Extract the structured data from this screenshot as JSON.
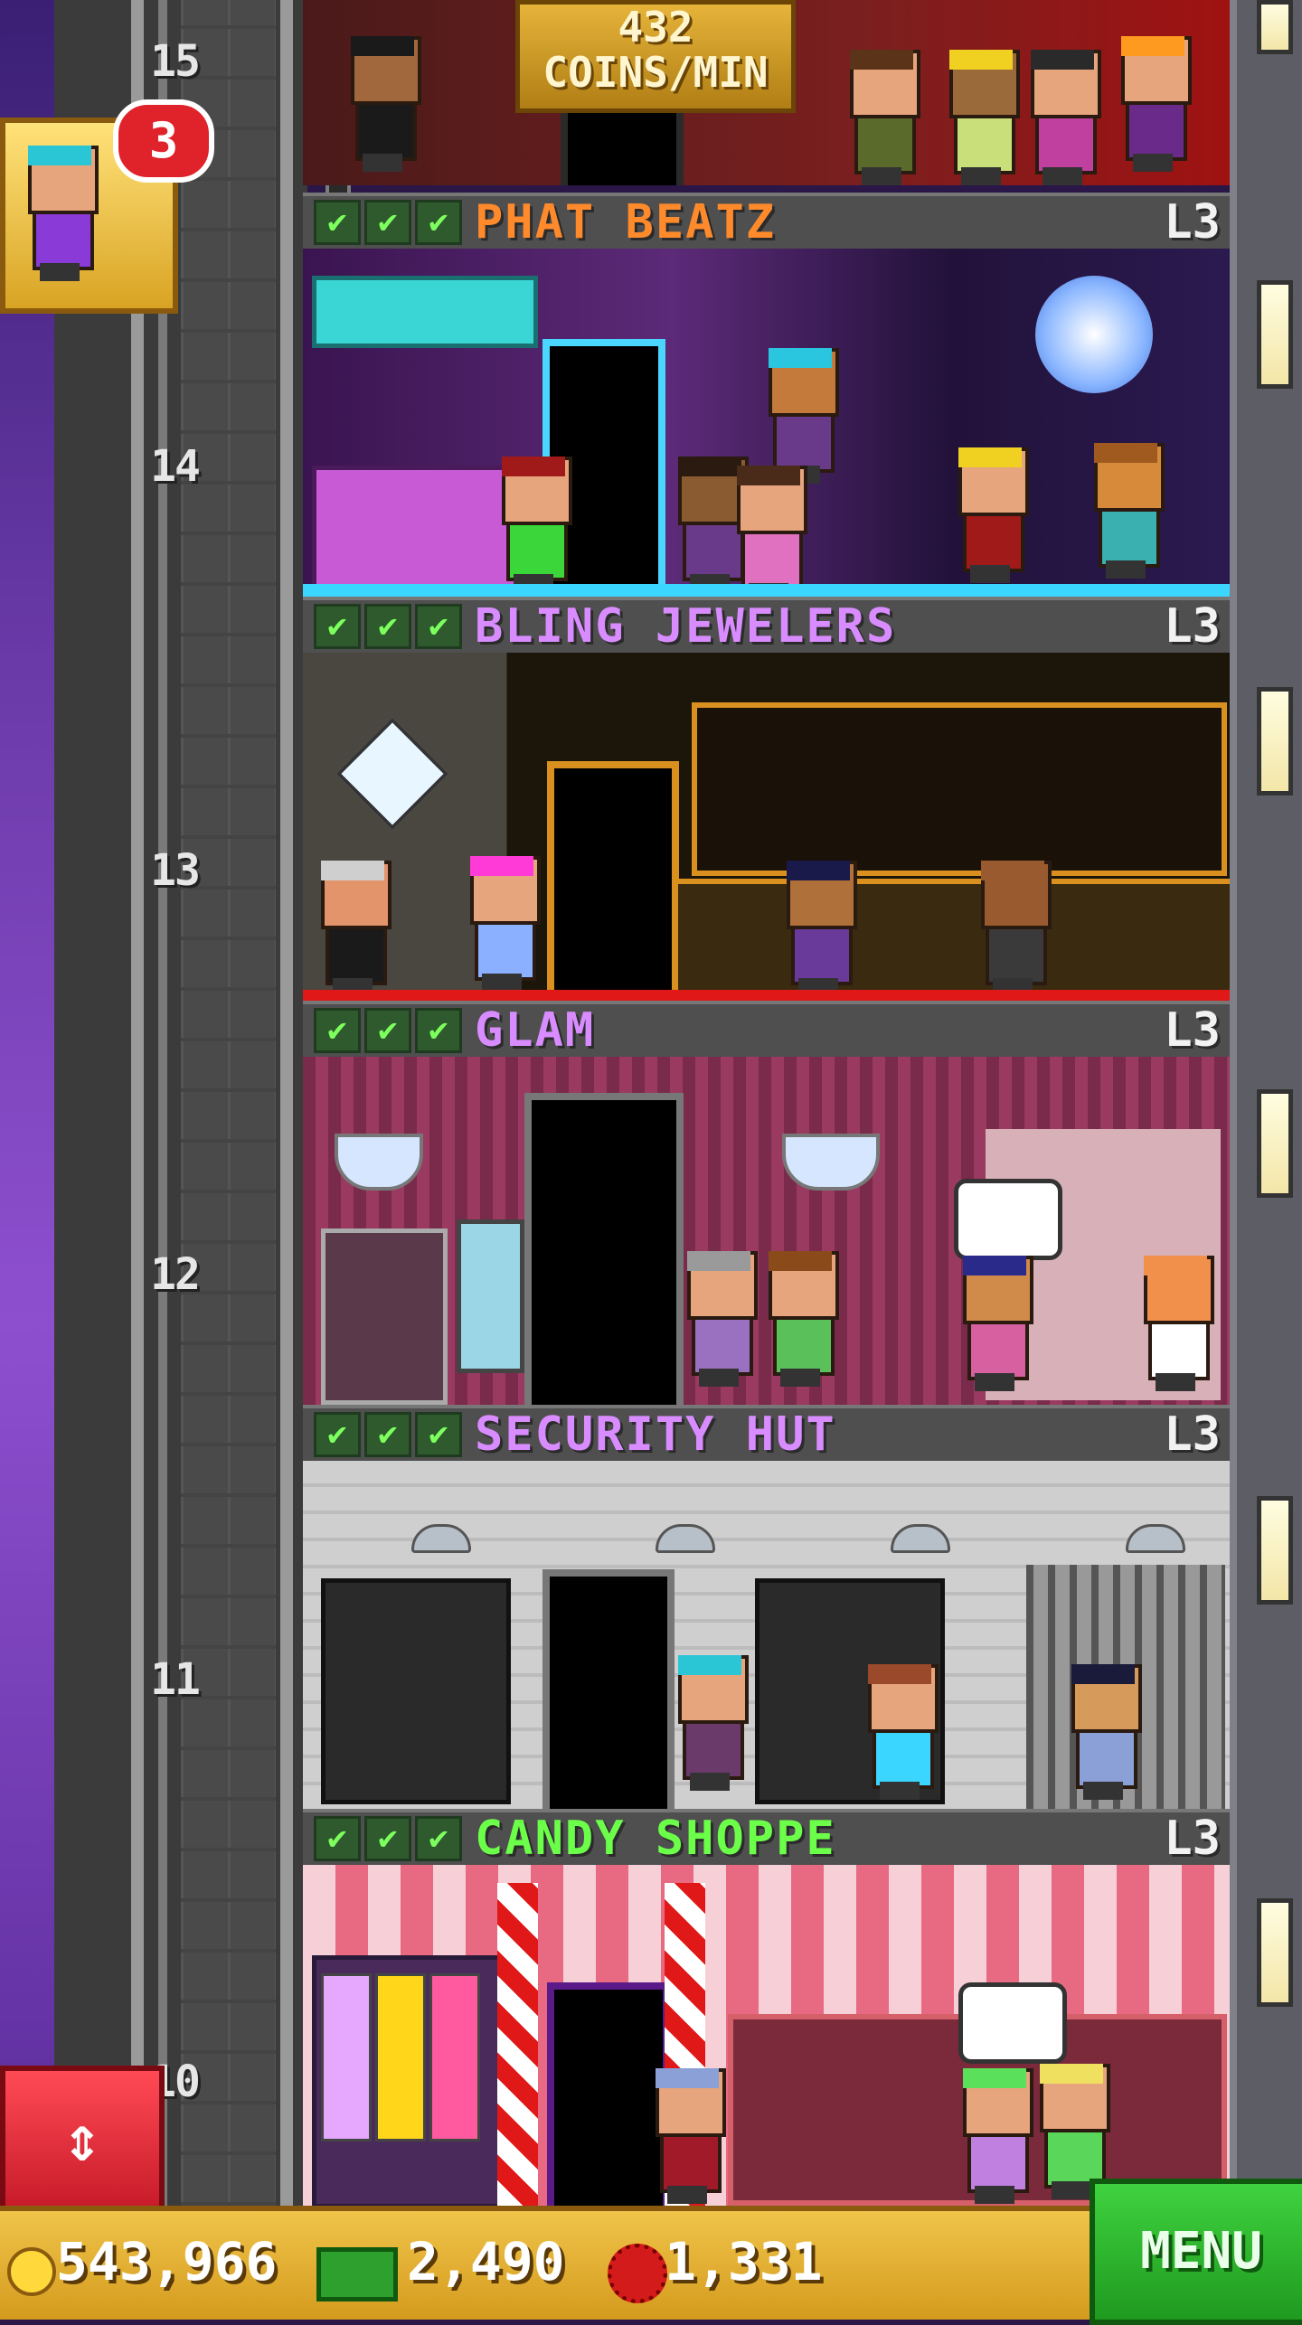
{
  "top_floor": {
    "number": "15",
    "coins_per_min_value": "432",
    "coins_per_min_label": "COINS/MIN"
  },
  "notification": {
    "count": "3"
  },
  "floors": [
    {
      "number": "14",
      "name": "PHAT BEATZ",
      "level": "L3",
      "name_color": "#ff8a2b",
      "checks": [
        "✔",
        "✔",
        "✔"
      ]
    },
    {
      "number": "13",
      "name": "BLING JEWELERS",
      "level": "L3",
      "name_color": "#d98cff",
      "checks": [
        "✔",
        "✔",
        "✔"
      ]
    },
    {
      "number": "12",
      "name": "GLAM",
      "level": "L3",
      "name_color": "#d98cff",
      "checks": [
        "✔",
        "✔",
        "✔"
      ]
    },
    {
      "number": "11",
      "name": "SECURITY HUT",
      "level": "L3",
      "name_color": "#d98cff",
      "checks": [
        "✔",
        "✔",
        "✔"
      ]
    },
    {
      "number": "10",
      "name": "CANDY SHOPPE",
      "level": "L3",
      "name_color": "#6cff4a",
      "checks": [
        "✔",
        "✔",
        "✔"
      ]
    }
  ],
  "bottom_bar": {
    "coins": "543,966",
    "bux_cash": "2,490",
    "tower_bux": "1,331",
    "menu_label": "MENU"
  },
  "icons": {
    "coin": "coin-icon",
    "cash": "cash-icon",
    "bux": "bux-icon",
    "elevator": "elevator-up-down-icon"
  }
}
